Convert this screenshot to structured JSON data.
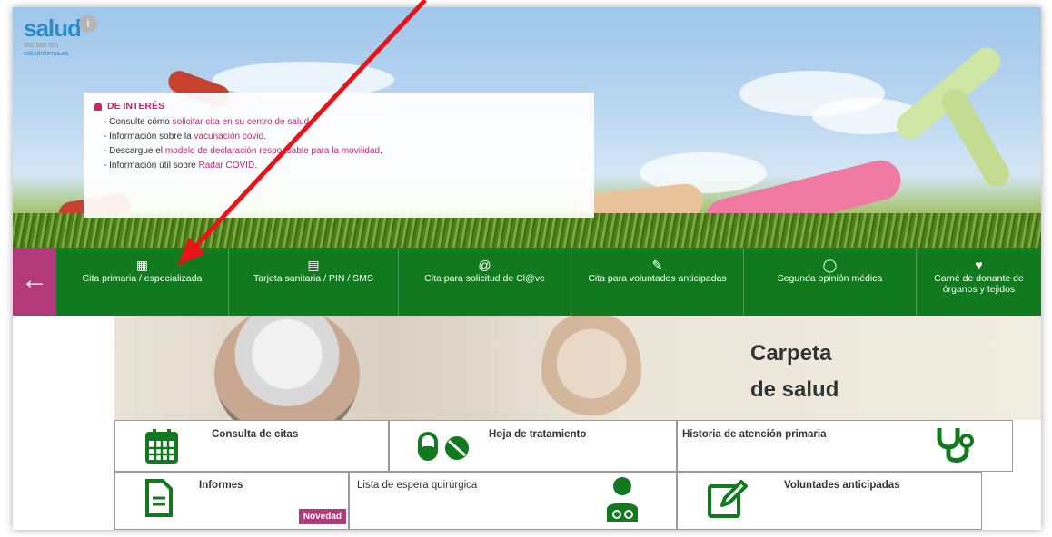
{
  "logo": {
    "word": "salud",
    "badge": "i",
    "phone": "902 505 321",
    "site": "saludinforma.es"
  },
  "notice": {
    "title": "DE INTERÉS",
    "lines": [
      {
        "prefix": "- Consulte cómo ",
        "link": "solicitar cita en su centro de salud",
        "suffix": "."
      },
      {
        "prefix": "- Información sobre la ",
        "link": "vacunación covid",
        "suffix": "."
      },
      {
        "prefix": "- Descargue el ",
        "link": "modelo de declaración responsable para la movilidad",
        "suffix": "."
      },
      {
        "prefix": "- Información útil sobre ",
        "link": "Radar COVID",
        "suffix": "."
      }
    ]
  },
  "nav": {
    "back_icon": "arrow-left-icon",
    "items": [
      {
        "label": "Cita primaria / especializada",
        "icon": "calendar-icon"
      },
      {
        "label": "Tarjeta sanitaria / PIN / SMS",
        "icon": "card-icon"
      },
      {
        "label": "Cita para solicitud de Cl@ve",
        "icon": "at-icon"
      },
      {
        "label": "Cita para voluntades anticipadas",
        "icon": "signed-document-icon"
      },
      {
        "label": "Segunda opinión médica",
        "icon": "chat-icon"
      },
      {
        "label": "Carné de donante de órganos y tejidos",
        "icon": "heart-icon"
      }
    ]
  },
  "carpeta": {
    "line1": "Carpeta",
    "line2": "de salud"
  },
  "grid": {
    "consulta": "Consulta de citas",
    "hoja": "Hoja de tratamiento",
    "historia": "Historia de atención primaria",
    "informes": "Informes",
    "novedad": "Novedad",
    "espera": "Lista de espera quirúrgica",
    "voluntades": "Voluntades anticipadas"
  },
  "colors": {
    "nav_green": "#117a1e",
    "accent_pink": "#b33a7a",
    "link_pink": "#c7266f",
    "arrow_red": "#e8141a"
  }
}
